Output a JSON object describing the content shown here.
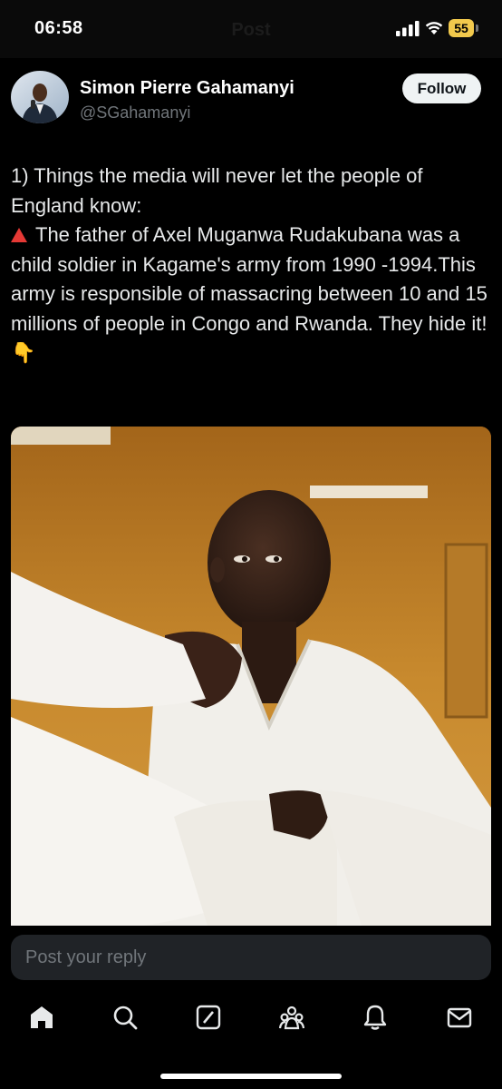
{
  "status_bar": {
    "time": "06:58",
    "faded_title": "Post",
    "battery_level": "55",
    "icons": [
      "signal-icon",
      "wifi-icon",
      "battery-icon"
    ]
  },
  "post": {
    "author": {
      "display_name": "Simon Pierre Gahamanyi",
      "handle": "@SGahamanyi"
    },
    "follow_label": "Follow",
    "text": {
      "line1": "1) Things the media will never let the people of England know:",
      "line2": "The father of Axel Muganwa Rudakubana was a child soldier in Kagame's army from 1990 -1994.This army is responsible of massacring between 10 and 15 millions of people in Congo and Rwanda. They hide it!",
      "emoji_warning": "red-triangle-icon",
      "emoji_point": "👇"
    }
  },
  "reply": {
    "placeholder": "Post your reply"
  },
  "bottom_nav": {
    "items": [
      "home-icon",
      "search-icon",
      "grok-icon",
      "communities-icon",
      "notifications-icon",
      "messages-icon"
    ],
    "active": "home-icon"
  },
  "colors": {
    "background": "#000000",
    "text": "#e7e9ea",
    "secondary_text": "#71767b",
    "battery": "#f2c94c"
  }
}
